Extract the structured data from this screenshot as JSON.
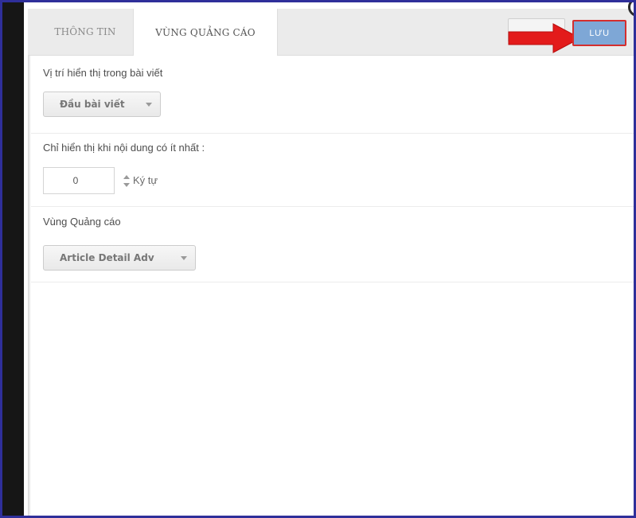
{
  "tabs": [
    {
      "label": "THÔNG TIN"
    },
    {
      "label": "VÙNG QUẢNG CÁO"
    }
  ],
  "toolbar": {
    "save_label": "LƯU",
    "accent_color": "#7ea7d6",
    "highlight_color": "#d42e2e"
  },
  "position_section": {
    "label": "Vị trí hiển thị trong bài viết",
    "selected": "Đầu bài viết"
  },
  "min_content_section": {
    "label": "Chỉ hiển thị khi nội dung có ít nhất :",
    "value": "0",
    "unit": "Ký tự"
  },
  "ad_zone_section": {
    "label": "Vùng Quảng cáo",
    "selected": "Article Detail Adv"
  },
  "icons": [
    "red-arrow-icon",
    "caret-down-icon",
    "spinner-up-icon",
    "spinner-down-icon",
    "close-icon"
  ]
}
